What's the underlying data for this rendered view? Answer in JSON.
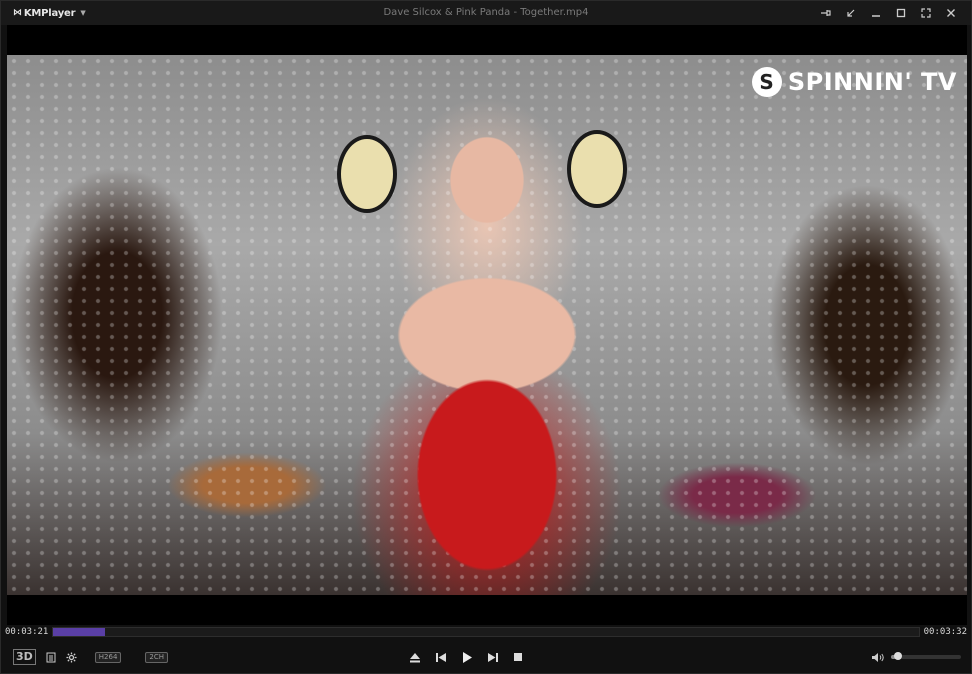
{
  "app": {
    "name": "KMPlayer",
    "window_title": "Dave Silcox & Pink Panda - Together.mp4"
  },
  "video": {
    "watermark": "SPINNIN' TV",
    "watermark_badge": "S"
  },
  "playback": {
    "elapsed": "00:03:21",
    "total": "00:03:32",
    "progress": 0.06,
    "volume": 0.07
  },
  "controls": {
    "badge_3d": "3D",
    "codec_tag": "H264",
    "channel_tag": "2CH"
  },
  "colors": {
    "accent": "#5a3fa6"
  },
  "icons": {
    "pin": "pin-icon",
    "mini": "mini-mode-icon",
    "minimize": "minimize-icon",
    "maximize": "maximize-icon",
    "fullscreen": "fullscreen-icon",
    "close": "close-icon",
    "playlist": "playlist-icon",
    "settings": "gear-icon",
    "eject": "eject-icon",
    "prev": "previous-icon",
    "play": "play-icon",
    "next": "next-icon",
    "stop": "stop-icon",
    "volume": "volume-icon"
  }
}
